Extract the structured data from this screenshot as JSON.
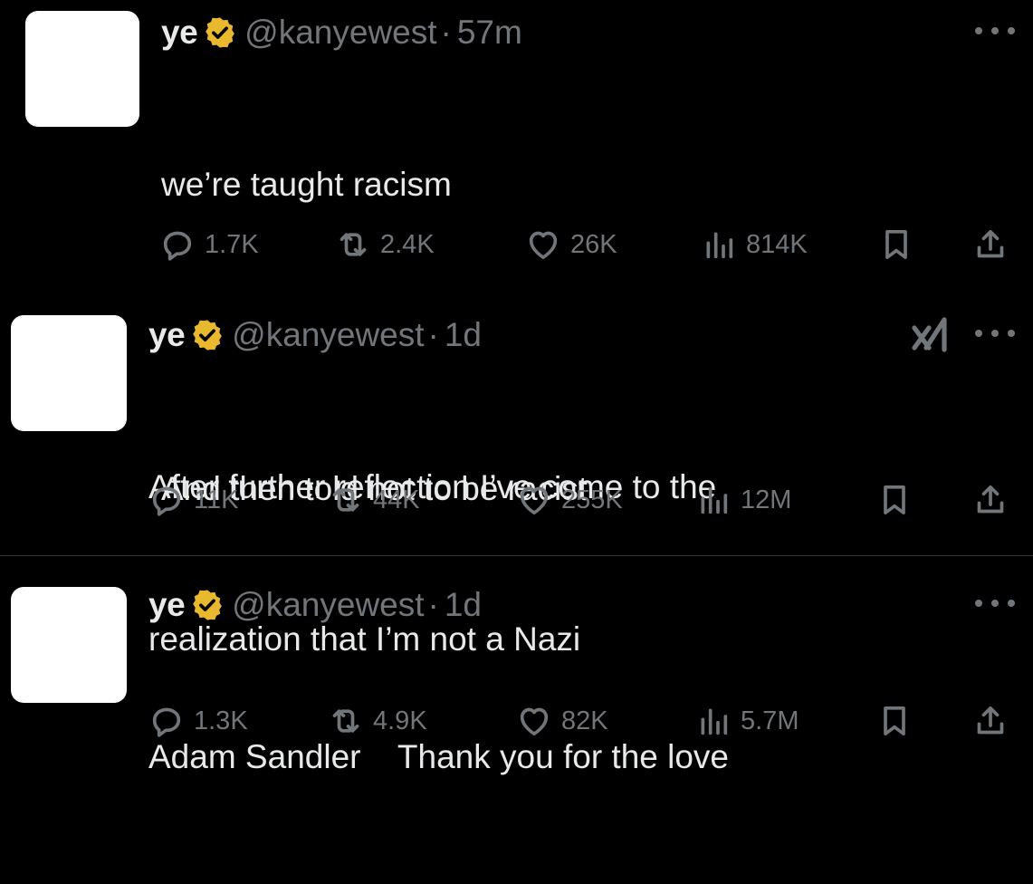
{
  "tweets": [
    {
      "name": "ye",
      "handle": "@kanyewest",
      "separator": "·",
      "time": "57m",
      "text_lines": [
        "we’re taught racism",
        "",
        "And then told not to be racist"
      ],
      "replies": "1.7K",
      "retweets": "2.4K",
      "likes": "26K",
      "views": "814K"
    },
    {
      "name": "ye",
      "handle": "@kanyewest",
      "separator": "·",
      "time": "1d",
      "text_lines": [
        "After further reflection I’ve come to the",
        "realization that I’m not a Nazi"
      ],
      "replies": "11K",
      "retweets": "44K",
      "likes": "255K",
      "views": "12M"
    },
    {
      "name": "ye",
      "handle": "@kanyewest",
      "separator": "·",
      "time": "1d",
      "text_lines": [
        "Adam Sandler    Thank you for the love"
      ],
      "replies": "1.3K",
      "retweets": "4.9K",
      "likes": "82K",
      "views": "5.7M"
    }
  ],
  "icons": {
    "verified_badge": "verified-badge-icon",
    "reply": "reply-icon",
    "retweet": "retweet-icon",
    "like": "heart-icon",
    "views": "views-icon",
    "bookmark": "bookmark-icon",
    "share": "share-icon",
    "more": "more-icon",
    "grok": "grok-icon"
  },
  "colors": {
    "background": "#000000",
    "text": "#e7e9ea",
    "muted": "#71767b",
    "verified_gold": "#e8b82e",
    "divider": "#2f3336"
  }
}
